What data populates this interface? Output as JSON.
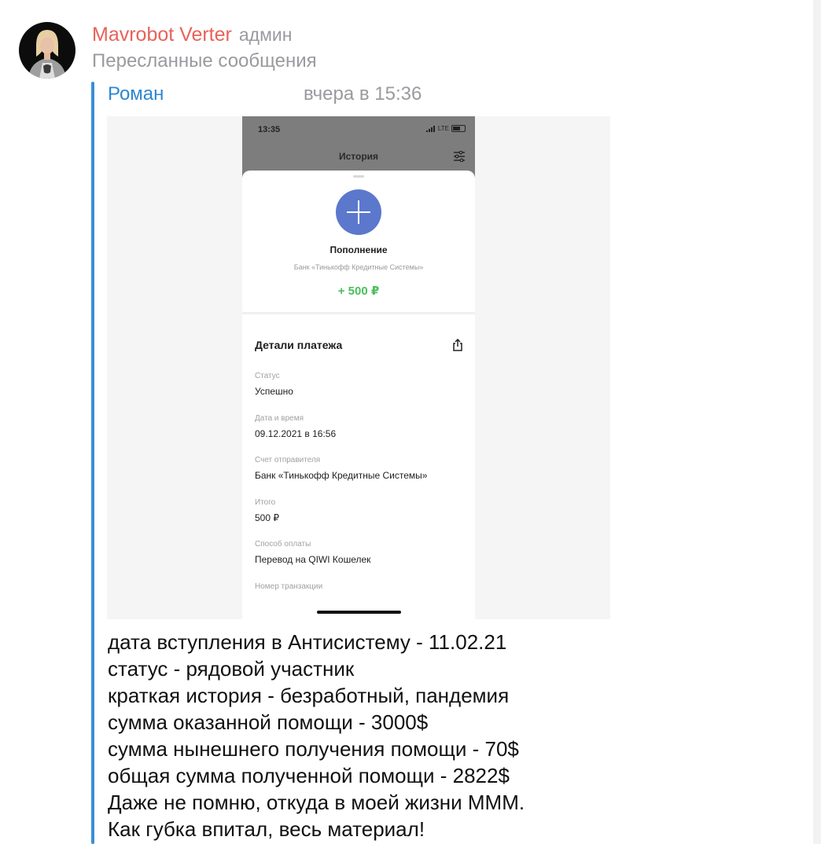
{
  "message": {
    "sender_name": "Mavrobot Verter",
    "sender_role": "админ",
    "forward_label": "Пересланные сообщения",
    "forwarded_from": "Роман",
    "forwarded_date": "вчера в 15:36",
    "text_lines": [
      "дата вступления в Антисистему - 11.02.21",
      "статус - рядовой участник",
      "краткая история - безработный, пандемия",
      "сумма оказанной помощи - 3000$",
      "сумма нынешнего получения помощи - 70$",
      "общая сумма полученной помощи - 2822$",
      "Даже не помню, откуда в моей жизни МММ.",
      "Как губка впитал, весь материал!"
    ]
  },
  "screenshot": {
    "status_time": "13:35",
    "network": "LTE",
    "screen_title": "История",
    "operation_title": "Пополнение",
    "operation_bank": "Банк «Тинькофф Кредитные Системы»",
    "operation_amount": "+ 500 ₽",
    "details_title": "Детали платежа",
    "details": [
      {
        "label": "Статус",
        "value": "Успешно"
      },
      {
        "label": "Дата и время",
        "value": "09.12.2021 в 16:56"
      },
      {
        "label": "Счет отправителя",
        "value": "Банк «Тинькофф Кредитные Системы»"
      },
      {
        "label": "Итого",
        "value": "500 ₽"
      },
      {
        "label": "Способ оплаты",
        "value": "Перевод на QIWI Кошелек"
      },
      {
        "label": "Номер транзакции",
        "value": ""
      }
    ]
  },
  "colors": {
    "sender_name": "#e8625a",
    "forward_bar": "#3a8fd6",
    "forward_author": "#2e86d1",
    "amount_green": "#4cbf5d",
    "plus_circle": "#5b78cc"
  },
  "icons": [
    "user-avatar",
    "filter-icon",
    "plus-icon",
    "share-icon",
    "battery-icon",
    "signal-icon"
  ]
}
